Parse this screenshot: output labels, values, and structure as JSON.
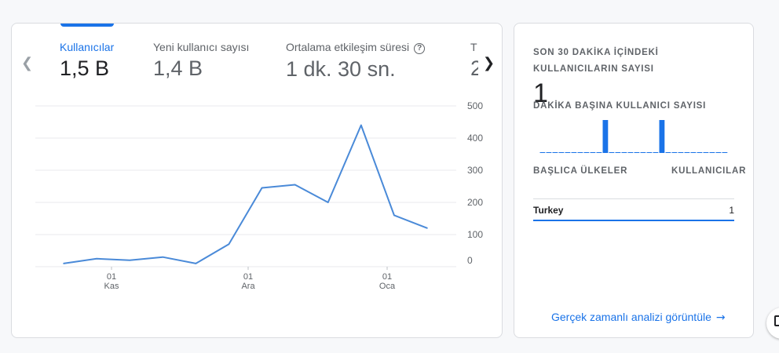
{
  "metrics": [
    {
      "label": "Kullanıcılar",
      "value": "1,5 B"
    },
    {
      "label": "Yeni kullanıcı sayısı",
      "value": "1,4 B"
    },
    {
      "label": "Ortalama etkileşim süresi",
      "value": "1 dk. 30 sn."
    },
    {
      "label": "T",
      "value": "2"
    }
  ],
  "icons": {
    "prev": "chevron-left-icon",
    "next": "chevron-right-icon",
    "help": "help-circle-icon",
    "arrow": "arrow-right-icon",
    "feedback": "feedback-icon"
  },
  "colors": {
    "accent": "#1a73e8",
    "line": "#4a8ad8"
  },
  "chart_data": {
    "type": "line",
    "x_ticks": [
      {
        "day": "01",
        "month": "Kas"
      },
      {
        "day": "01",
        "month": "Ara"
      },
      {
        "day": "01",
        "month": "Oca"
      }
    ],
    "y_ticks": [
      0,
      100,
      200,
      300,
      400,
      500
    ],
    "ylim": [
      0,
      500
    ],
    "series": [
      {
        "values": [
          10,
          25,
          20,
          30,
          10,
          70,
          245,
          255,
          200,
          440,
          160,
          120
        ]
      }
    ],
    "grid": true
  },
  "realtime": {
    "title": "SON 30 DAKİKA İÇİNDEKİ KULLANICILARIN SAYISI",
    "count": "1",
    "per_minute_label": "DAKİKA BAŞINA KULLANICI SAYISI",
    "per_minute_values": [
      0,
      0,
      0,
      0,
      0,
      0,
      0,
      0,
      0,
      0,
      1,
      0,
      0,
      0,
      0,
      0,
      0,
      0,
      0,
      1,
      0,
      0,
      0,
      0,
      0,
      0,
      0,
      0,
      0,
      0
    ],
    "table_headers": {
      "country": "BAŞLICA ÜLKELER",
      "users": "KULLANICILAR"
    },
    "rows": [
      {
        "country": "Turkey",
        "users": "1"
      }
    ],
    "link": "Gerçek zamanlı analizi görüntüle"
  }
}
